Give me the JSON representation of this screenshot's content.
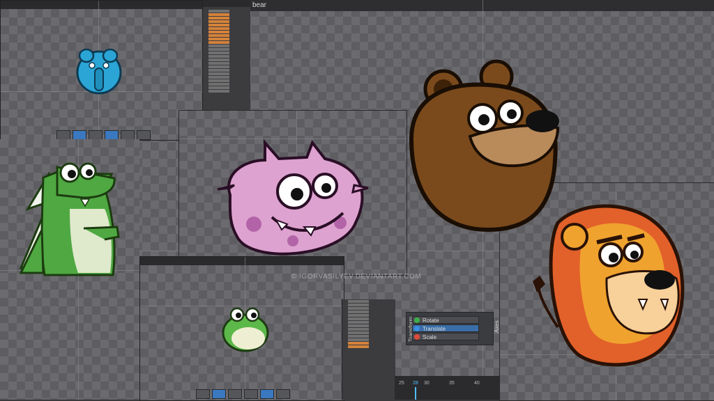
{
  "window": {
    "title": "bear"
  },
  "watermark": "© IGORVASILYEV.DEVIANTART.COM",
  "transform_panel": {
    "title": "Transform",
    "axes_label": "Axes",
    "buttons": [
      {
        "label": "Rotate",
        "color": "#3cae4a",
        "state": "normal"
      },
      {
        "label": "Translate",
        "color": "#3a8fe0",
        "state": "active"
      },
      {
        "label": "Scale",
        "color": "#e04a3a",
        "state": "normal"
      }
    ]
  },
  "timeline": {
    "ticks": [
      "25",
      "28",
      "30",
      "35",
      "40"
    ]
  },
  "characters": [
    {
      "name": "elephant",
      "color": "#2aa5d6"
    },
    {
      "name": "crocodile",
      "color": "#4fa842"
    },
    {
      "name": "pink-monster",
      "color": "#dda2cf"
    },
    {
      "name": "bear",
      "color": "#7a4a1c"
    },
    {
      "name": "frog",
      "color": "#5db84a"
    },
    {
      "name": "lion",
      "color": "#f0a22e"
    }
  ]
}
